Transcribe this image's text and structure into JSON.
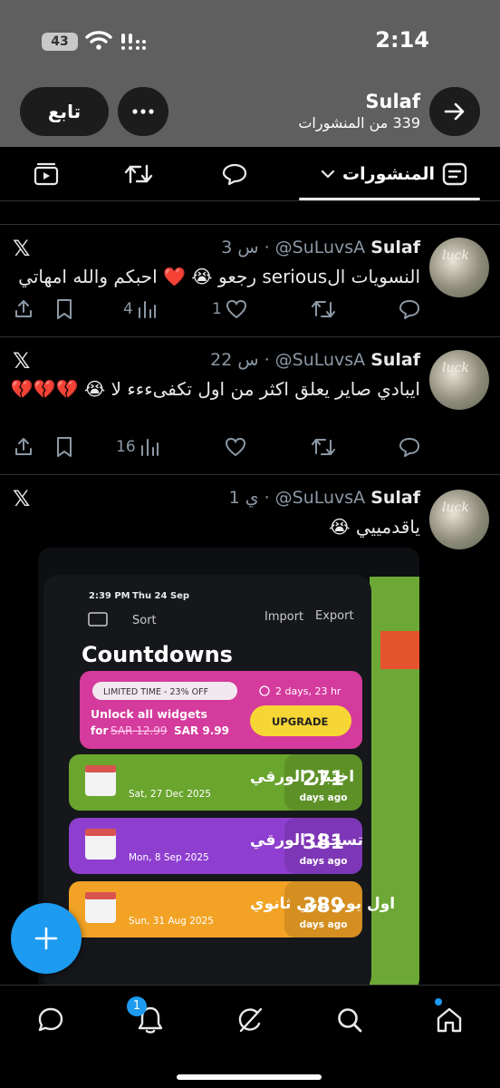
{
  "status_bar": {
    "time": "2:14",
    "battery": "43"
  },
  "header": {
    "name": "Sulaf",
    "post_count": "339 من المنشورات",
    "follow_label": "تابع"
  },
  "tabs": {
    "posts_label": "المنشورات"
  },
  "posts": [
    {
      "name": "Sulaf",
      "handle": "@SuLuvsA",
      "time": "3 س",
      "text": "النسويات الserious رجعو 😭 ❤️ احبكم والله امهاتي",
      "views": "4",
      "likes": "1"
    },
    {
      "name": "Sulaf",
      "handle": "@SuLuvsA",
      "time": "22 س",
      "text": "ايبادي صاير يعلق اكثر من اول تكفىءءء لا 😭 💔💔💔",
      "views": "16"
    },
    {
      "name": "Sulaf",
      "handle": "@SuLuvsA",
      "time": "1 ي",
      "text": "ياقدمييي 😭"
    }
  ],
  "photo": {
    "time": "2:39 PM",
    "date": "Thu 24 Sep",
    "sort": "Sort",
    "import": "Import",
    "export": "Export",
    "title": "Countdowns",
    "promo": {
      "tag": "LIMITED TIME - 23% OFF",
      "timer": "2 days, 23 hr",
      "line1": "Unlock all widgets",
      "old_price": "SAR 12.99",
      "new_price": "SAR 9.99",
      "upgrade": "UPGRADE",
      "for": "for"
    },
    "items": [
      {
        "title": "اختبار الورقي",
        "date": "Sat, 27 Dec 2025",
        "days": "271",
        "unit": "days ago",
        "color": "#6aa52e"
      },
      {
        "title": "تسجيل الورقي",
        "date": "Mon, 8 Sep 2025",
        "days": "381",
        "unit": "days ago",
        "color": "#8f3fd0"
      },
      {
        "title": "اول يوم ثاني ثانوي",
        "date": "Sun, 31 Aug 2025",
        "days": "389",
        "unit": "days ago",
        "color": "#f2a325"
      }
    ]
  },
  "bottom_nav": {
    "notification_badge": "1"
  },
  "colors": {
    "accent": "#1d9bf0",
    "header_bg": "#5f5f5f"
  }
}
